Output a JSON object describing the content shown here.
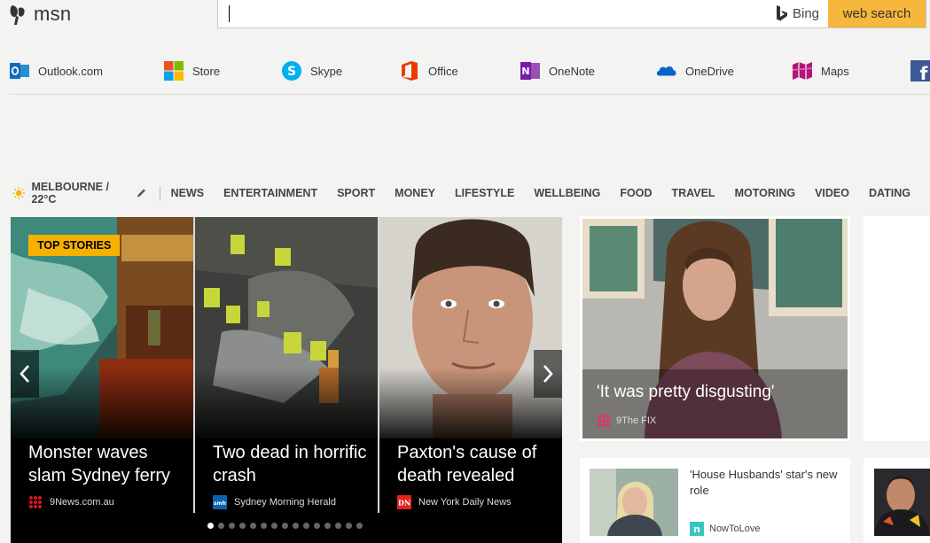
{
  "header": {
    "logo_text": "msn",
    "search": {
      "value": "",
      "placeholder": ""
    },
    "bing_label": "Bing",
    "search_button": "web search",
    "colors": {
      "accent": "#f6b73c"
    }
  },
  "apps": [
    {
      "label": "Outlook.com",
      "icon": "outlook-icon"
    },
    {
      "label": "Store",
      "icon": "store-icon"
    },
    {
      "label": "Skype",
      "icon": "skype-icon"
    },
    {
      "label": "Office",
      "icon": "office-icon"
    },
    {
      "label": "OneNote",
      "icon": "onenote-icon"
    },
    {
      "label": "OneDrive",
      "icon": "onedrive-icon"
    },
    {
      "label": "Maps",
      "icon": "maps-icon"
    },
    {
      "label": "",
      "icon": "facebook-icon"
    }
  ],
  "nav": {
    "weather": "MELBOURNE / 22°C",
    "items": [
      "NEWS",
      "ENTERTAINMENT",
      "SPORT",
      "MONEY",
      "LIFESTYLE",
      "WELLBEING",
      "FOOD",
      "TRAVEL",
      "MOTORING",
      "VIDEO",
      "DATING"
    ]
  },
  "carousel": {
    "badge": "TOP STORIES",
    "slides": [
      {
        "headline": "Monster waves slam Sydney ferry",
        "source": "9News.com.au",
        "source_icon": "9news-icon"
      },
      {
        "headline": "Two dead in horrific crash",
        "source": "Sydney Morning Herald",
        "source_icon": "smh-icon"
      },
      {
        "headline": "Paxton's cause of death revealed",
        "source": "New York Daily News",
        "source_icon": "nydn-icon"
      }
    ],
    "dot_count": 15,
    "active_dot": 0
  },
  "feature": {
    "headline": "'It was pretty disgusting'",
    "source": "9The FIX",
    "source_icon": "9fix-icon"
  },
  "small_card": {
    "title": "'House Husbands' star's new role",
    "source": "NowToLove",
    "source_icon": "nowtolove-icon"
  }
}
